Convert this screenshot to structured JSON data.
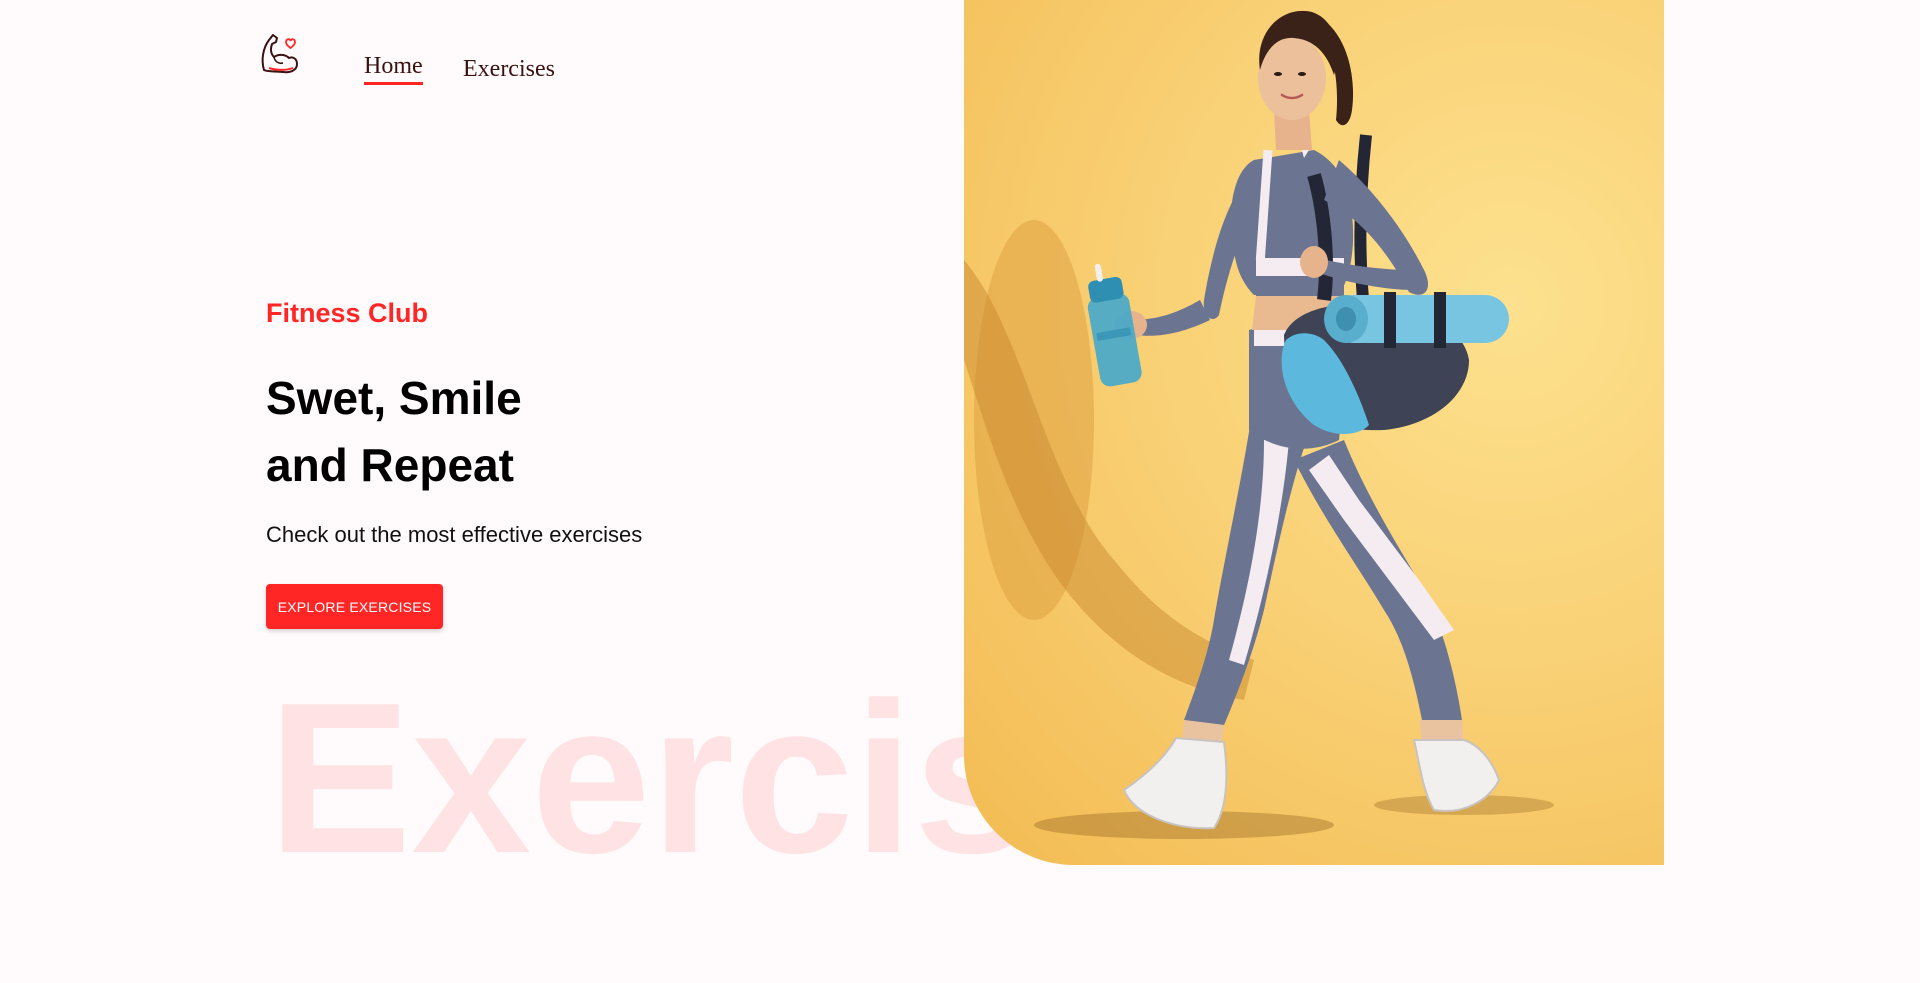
{
  "nav": {
    "logo_icon": "flexed-arm-heart-icon",
    "links": [
      {
        "label": "Home",
        "active": true
      },
      {
        "label": "Exercises",
        "active": false
      }
    ]
  },
  "hero": {
    "tag": "Fitness Club",
    "title_line1": "Swet, Smile",
    "title_line2": "and Repeat",
    "subtitle": "Check out the most effective exercises",
    "button_label": "EXPLORE EXERCISES",
    "background_word": "Exercis"
  },
  "banner": {
    "image_description_icon": "woman-walking-with-gym-bag-image"
  },
  "colors": {
    "accent": "#ff2625",
    "nav_text": "#3a1212",
    "page_background": "#fffafb",
    "banner_background": "#f9d176"
  }
}
